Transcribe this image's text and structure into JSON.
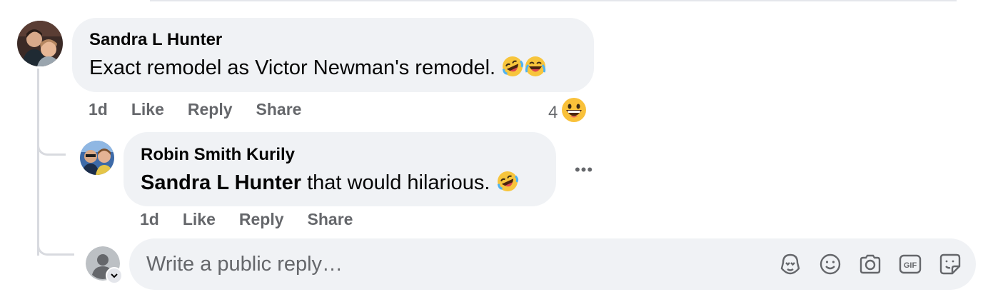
{
  "comment": {
    "author": "Sandra L Hunter",
    "text": "Exact remodel as Victor Newman's remodel.",
    "emojis": [
      "rolling-on-floor-laughing",
      "tears-of-joy"
    ],
    "timestamp": "1d",
    "actions": {
      "like": "Like",
      "reply": "Reply",
      "share": "Share"
    },
    "reaction_count": "4",
    "reaction_type": "grinning-sweat"
  },
  "reply": {
    "author": "Robin Smith Kurily",
    "mention": "Sandra L Hunter",
    "text": " that would hilarious.",
    "emojis": [
      "rolling-on-floor-laughing"
    ],
    "timestamp": "1d",
    "actions": {
      "like": "Like",
      "reply": "Reply",
      "share": "Share"
    },
    "more_label": "•••"
  },
  "composer": {
    "placeholder": "Write a public reply…",
    "tools": [
      "avatar-sticker-icon",
      "emoji-icon",
      "camera-icon",
      "gif-icon",
      "sticker-icon"
    ]
  },
  "colors": {
    "bubble": "#f0f2f5",
    "secondary_text": "#65676b",
    "primary_text": "#050505",
    "thread_line": "#d8dadf"
  }
}
